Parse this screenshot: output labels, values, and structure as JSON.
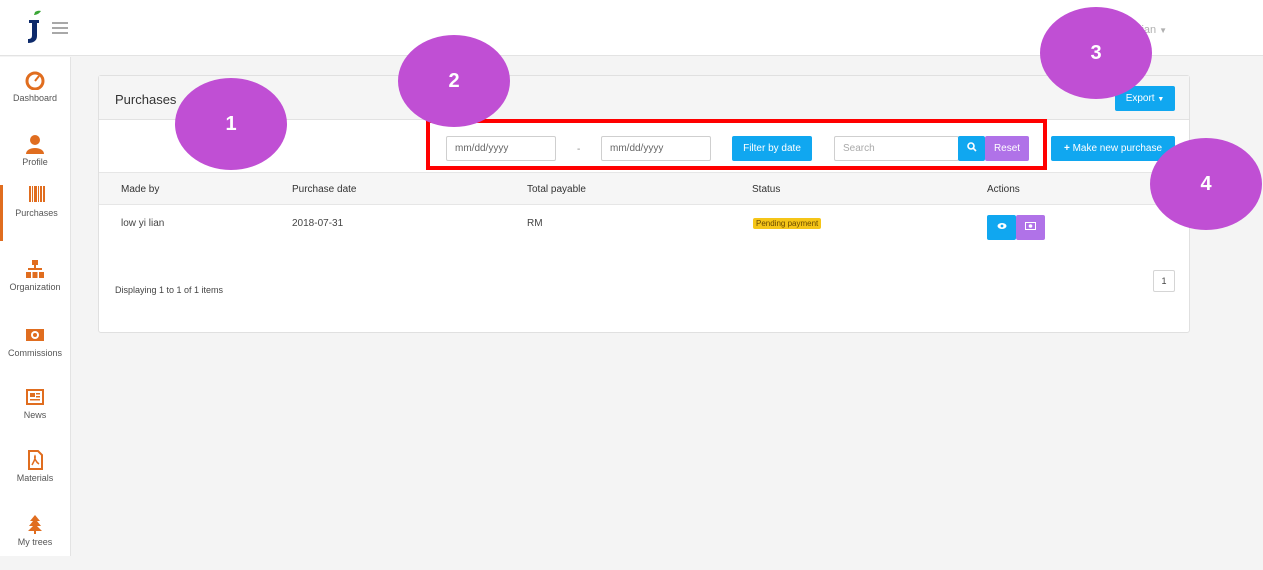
{
  "header": {
    "user_name": "yi lian"
  },
  "sidebar": {
    "items": [
      {
        "label": "Dashboard",
        "icon": "speedometer-icon"
      },
      {
        "label": "Profile",
        "icon": "user-icon"
      },
      {
        "label": "Purchases",
        "icon": "barcode-icon",
        "active": true
      },
      {
        "label": "Organization",
        "icon": "sitemap-icon"
      },
      {
        "label": "Commissions",
        "icon": "money-icon"
      },
      {
        "label": "News",
        "icon": "newspaper-icon"
      },
      {
        "label": "Materials",
        "icon": "pdf-icon"
      },
      {
        "label": "My trees",
        "icon": "tree-icon"
      }
    ]
  },
  "panel": {
    "title": "Purchases",
    "export_label": "Export",
    "filters": {
      "date_from_placeholder": "mm/dd/yyyy",
      "separator": "-",
      "date_to_placeholder": "mm/dd/yyyy",
      "filter_label": "Filter by date",
      "search_placeholder": "Search",
      "reset_label": "Reset"
    },
    "new_purchase_label": "Make new purchase",
    "table": {
      "columns": [
        "Made by",
        "Purchase date",
        "Total payable",
        "Status",
        "Actions"
      ],
      "rows": [
        {
          "made_by": "low yi lian",
          "purchase_date": "2018-07-31",
          "total_payable": "RM",
          "status": "Pending payment"
        }
      ]
    },
    "pagination": {
      "info": "Displaying 1 to 1 of 1 items",
      "current_page": "1"
    }
  },
  "callouts": [
    "1",
    "2",
    "3",
    "4"
  ],
  "colors": {
    "accent_blue": "#10a7f0",
    "accent_purple": "#b072e8",
    "sidebar_icon": "#e06d1f",
    "status_pending": "#f5c518",
    "highlight_frame": "#ff0000",
    "callout": "#c04fd4"
  }
}
